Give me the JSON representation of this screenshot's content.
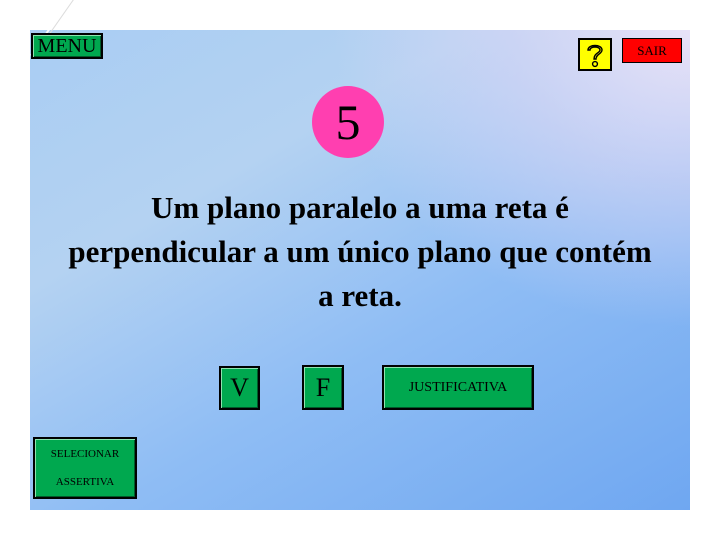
{
  "toolbar": {
    "menu_label": "MENU",
    "help_icon": "question-mark-icon",
    "exit_label": "SAIR"
  },
  "question": {
    "number": "5",
    "text": "Um plano paralelo a uma reta é perpendicular a um único plano que contém a reta."
  },
  "answers": {
    "true_label": "V",
    "false_label": "F",
    "justify_label": "JUSTIFICATIVA"
  },
  "select": {
    "line1": "SELECIONAR",
    "line2": "ASSERTIVA"
  },
  "colors": {
    "button_green": "#00a84f",
    "help_yellow": "#ffff00",
    "exit_red": "#ff0000",
    "number_pink": "#ff3fb0"
  }
}
